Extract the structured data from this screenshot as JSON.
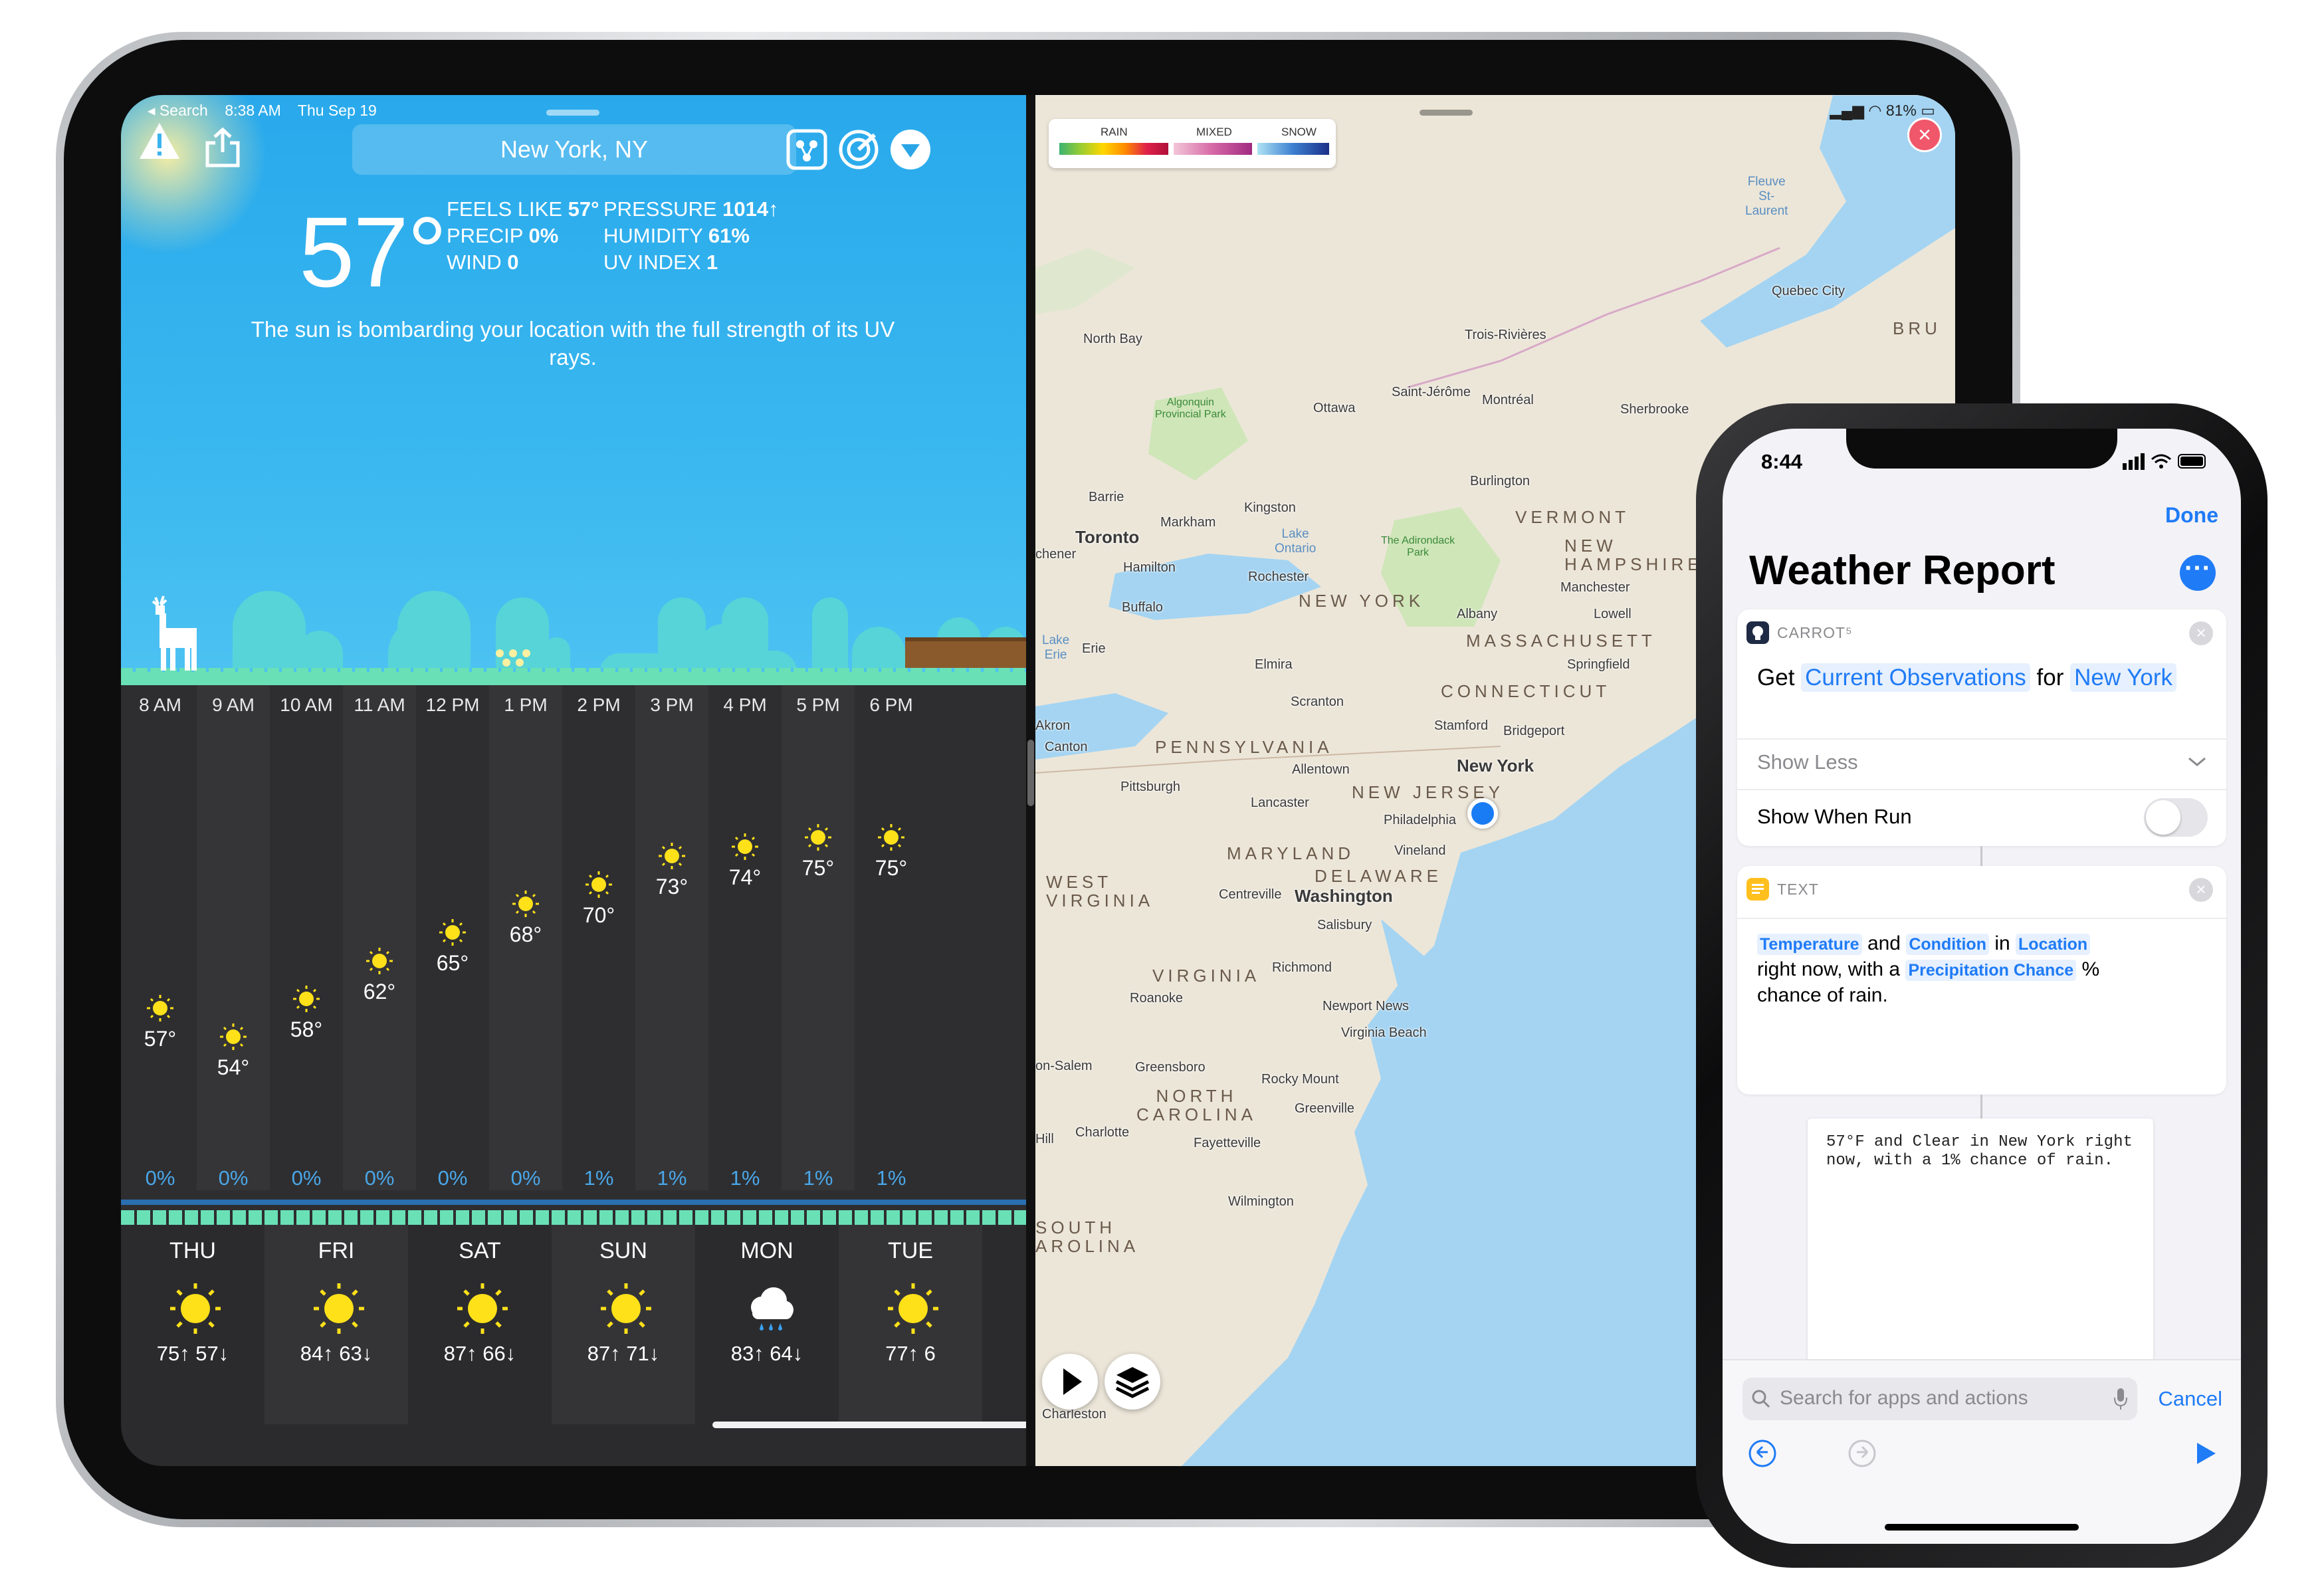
{
  "ipad": {
    "status": {
      "back": "◂ Search",
      "time": "8:38 AM",
      "date": "Thu Sep 19",
      "battery": "81%"
    },
    "weather": {
      "location": "New York, NY",
      "temperature": "57°",
      "feels_like_label": "FEELS LIKE",
      "feels_like": "57°",
      "precip_label": "PRECIP",
      "precip": "0%",
      "wind_label": "WIND",
      "wind": "0",
      "pressure_label": "PRESSURE",
      "pressure": "1014↑",
      "humidity_label": "HUMIDITY",
      "humidity": "61%",
      "uv_label": "UV INDEX",
      "uv": "1",
      "summary": "The sun is bombarding your location with the full strength of its UV rays.",
      "hourly": [
        {
          "time": "8 AM",
          "temp": "57°",
          "precip": "0%",
          "value": 57
        },
        {
          "time": "9 AM",
          "temp": "54°",
          "precip": "0%",
          "value": 54
        },
        {
          "time": "10 AM",
          "temp": "58°",
          "precip": "0%",
          "value": 58
        },
        {
          "time": "11 AM",
          "temp": "62°",
          "precip": "0%",
          "value": 62
        },
        {
          "time": "12 PM",
          "temp": "65°",
          "precip": "0%",
          "value": 65
        },
        {
          "time": "1 PM",
          "temp": "68°",
          "precip": "0%",
          "value": 68
        },
        {
          "time": "2 PM",
          "temp": "70°",
          "precip": "1%",
          "value": 70
        },
        {
          "time": "3 PM",
          "temp": "73°",
          "precip": "1%",
          "value": 73
        },
        {
          "time": "4 PM",
          "temp": "74°",
          "precip": "1%",
          "value": 74
        },
        {
          "time": "5 PM",
          "temp": "75°",
          "precip": "1%",
          "value": 75
        },
        {
          "time": "6 PM",
          "temp": "75°",
          "precip": "1%",
          "value": 75
        }
      ],
      "daily": [
        {
          "day": "THU",
          "temps": "75↑ 57↓",
          "icon": "sun-icon"
        },
        {
          "day": "FRI",
          "temps": "84↑ 63↓",
          "icon": "sun-icon"
        },
        {
          "day": "SAT",
          "temps": "87↑ 66↓",
          "icon": "sun-icon"
        },
        {
          "day": "SUN",
          "temps": "87↑ 71↓",
          "icon": "sun-icon"
        },
        {
          "day": "MON",
          "temps": "83↑ 64↓",
          "icon": "rain-cloud-icon"
        },
        {
          "day": "TUE",
          "temps": "77↑ 6",
          "icon": "sun-icon"
        }
      ]
    },
    "map": {
      "legend": {
        "rain": "RAIN",
        "mixed": "MIXED",
        "snow": "SNOW"
      },
      "places": {
        "fleuve": "Fleuve\nSt-\nLaurent",
        "quebec": "Quebec City",
        "bru": "BRU",
        "trois": "Trois-Rivières",
        "northbay": "North Bay",
        "algonquin": "Algonquin\nProvincial Park",
        "ottawa": "Ottawa",
        "stjerome": "Saint-Jérôme",
        "montreal": "Montréal",
        "sherbrooke": "Sherbrooke",
        "burlington": "Burlington",
        "barrie": "Barrie",
        "kingston": "Kingston",
        "vermont": "VERMONT",
        "adirondack": "The Adirondack\nPark",
        "newhampshire": "NEW\nHAMPSHIRE",
        "toronto": "Toronto",
        "markham": "Markham",
        "lakeontario": "Lake\nOntario",
        "chener": "chener",
        "hamilton": "Hamilton",
        "rochester": "Rochester",
        "manchester": "Manchester",
        "buffalo": "Buffalo",
        "newyorkstate": "NEW YORK",
        "albany": "Albany",
        "lowell": "Lowell",
        "massachusetts": "MASSACHUSETT",
        "lakeerie": "Lake\nErie",
        "erie": "Erie",
        "springfield": "Springfield",
        "elmira": "Elmira",
        "connecticut": "CONNECTICUT",
        "scranton": "Scranton",
        "akron": "Akron",
        "stamford": "Stamford",
        "bridgeport": "Bridgeport",
        "canton": "Canton",
        "pennsylvania": "PENNSYLVANIA",
        "newyork": "New York",
        "allentown": "Allentown",
        "pittsburgh": "Pittsburgh",
        "newjersey": "NEW JERSEY",
        "lancaster": "Lancaster",
        "philadelphia": "Philadelphia",
        "maryland": "MARYLAND",
        "vineland": "Vineland",
        "delaware": "DELAWARE",
        "westvirginia": "WEST\nVIRGINIA",
        "centreville": "Centreville",
        "washington": "Washington",
        "salisbury": "Salisbury",
        "virginia": "VIRGINIA",
        "richmond": "Richmond",
        "roanoke": "Roanoke",
        "newportnews": "Newport News",
        "virginiabeach": "Virginia Beach",
        "salem": "on-Salem",
        "greensboro": "Greensboro",
        "rockymount": "Rocky Mount",
        "northcarolina": "NORTH\nCAROLINA",
        "greenville": "Greenville",
        "charlotte": "Charlotte",
        "fayetteville": "Fayetteville",
        "hill": "Hill",
        "wilmington": "Wilmington",
        "southcarolina": "SOUTH\nAROLINA",
        "charleston": "Charleston"
      }
    }
  },
  "iphone": {
    "status_time": "8:44",
    "done": "Done",
    "title": "Weather Report",
    "action1": {
      "app": "CARROT⁵",
      "get": "Get",
      "param1": "Current Observations",
      "for": "for",
      "param2": "New York",
      "show_less": "Show Less",
      "show_when_run": "Show When Run"
    },
    "action2": {
      "app": "TEXT",
      "token1": "Temperature",
      "and": "and",
      "token2": "Condition",
      "in": "in",
      "token3": "Location",
      "text1": "right now, with a",
      "token4": "Precipitation Chance",
      "pct": "%",
      "text2": "chance of rain."
    },
    "output": "57°F and Clear in New York right now, with a 1% chance of rain.",
    "search_placeholder": "Search for apps and actions",
    "cancel": "Cancel"
  },
  "colors": {
    "sky": "#39b7ef",
    "ios_blue": "#1f7bf6",
    "sun": "#ffe11a",
    "ground": "#69e0b5"
  }
}
